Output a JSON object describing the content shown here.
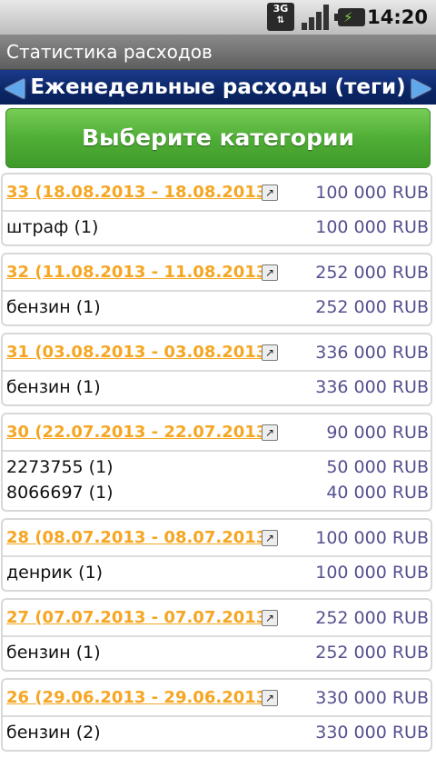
{
  "status_bar": {
    "network_label": "3G",
    "time": "14:20",
    "icons": [
      "3g-data-icon",
      "signal-strength-icon",
      "battery-charging-icon"
    ]
  },
  "title_bar": {
    "title": "Статистика расходов"
  },
  "period_nav": {
    "title": "Еженедельные расходы (теги)",
    "prev_icon": "arrow-left-icon",
    "next_icon": "arrow-right-icon"
  },
  "select_button": {
    "label": "Выберите категории",
    "color": "#4fae36"
  },
  "colors": {
    "week_link": "#f5a623",
    "amount": "#55508e",
    "nav_bar": "#0c2767"
  },
  "weeks": [
    {
      "title": "33 (18.08.2013 - 18.08.2013)",
      "total": "100 000 RUB",
      "rows": [
        {
          "label": "штраф (1)",
          "amount": "100 000 RUB"
        }
      ]
    },
    {
      "title": "32 (11.08.2013 - 11.08.2013)",
      "total": "252 000 RUB",
      "rows": [
        {
          "label": "бензин (1)",
          "amount": "252 000 RUB"
        }
      ]
    },
    {
      "title": "31 (03.08.2013 - 03.08.2013)",
      "total": "336 000 RUB",
      "rows": [
        {
          "label": "бензин (1)",
          "amount": "336 000 RUB"
        }
      ]
    },
    {
      "title": "30 (22.07.2013 - 22.07.2013)",
      "total": "90 000 RUB",
      "rows": [
        {
          "label": "2273755 (1)",
          "amount": "50 000 RUB"
        },
        {
          "label": "8066697 (1)",
          "amount": "40 000 RUB"
        }
      ]
    },
    {
      "title": "28 (08.07.2013 - 08.07.2013)",
      "total": "100 000 RUB",
      "rows": [
        {
          "label": "денрик (1)",
          "amount": "100 000 RUB"
        }
      ]
    },
    {
      "title": "27 (07.07.2013 - 07.07.2013)",
      "total": "252 000 RUB",
      "rows": [
        {
          "label": "бензин (1)",
          "amount": "252 000 RUB"
        }
      ]
    },
    {
      "title": "26 (29.06.2013 - 29.06.2013)",
      "total": "330 000 RUB",
      "rows": [
        {
          "label": "бензин (2)",
          "amount": "330 000 RUB"
        }
      ]
    }
  ]
}
